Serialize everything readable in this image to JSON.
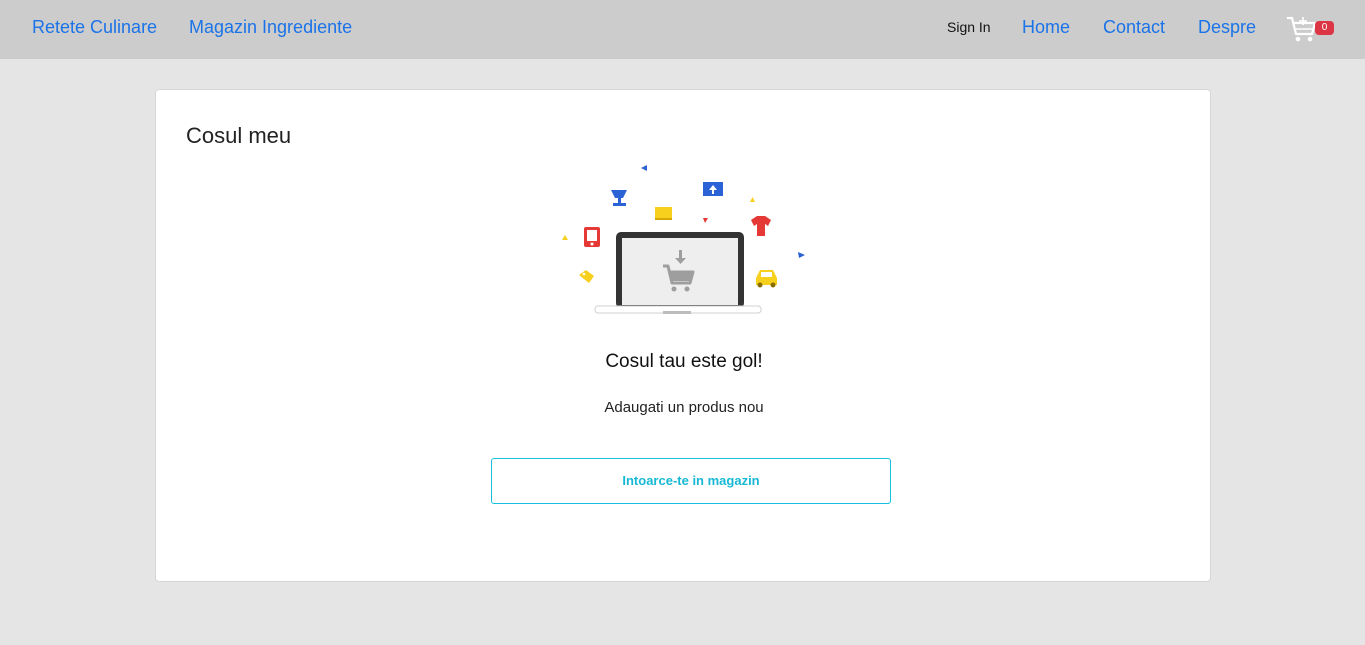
{
  "nav": {
    "left_links": [
      "Retete Culinare",
      "Magazin Ingrediente"
    ],
    "sign_in": "Sign In",
    "right_links": [
      "Home",
      "Contact",
      "Despre"
    ],
    "cart_count": "0",
    "cart_icon": "shopping-cart-icon"
  },
  "cart_page": {
    "title": "Cosul meu",
    "illustration_icon": "empty-cart-laptop-illustration",
    "empty_title": "Cosul tau este gol!",
    "empty_subtitle": "Adaugati un produs nou",
    "back_button": "Intoarce-te in magazin"
  },
  "colors": {
    "link": "#1a73e8",
    "navbar_bg": "#cccccc",
    "page_bg": "#e5e5e5",
    "badge": "#dc3545",
    "button_accent": "#17c1de"
  }
}
